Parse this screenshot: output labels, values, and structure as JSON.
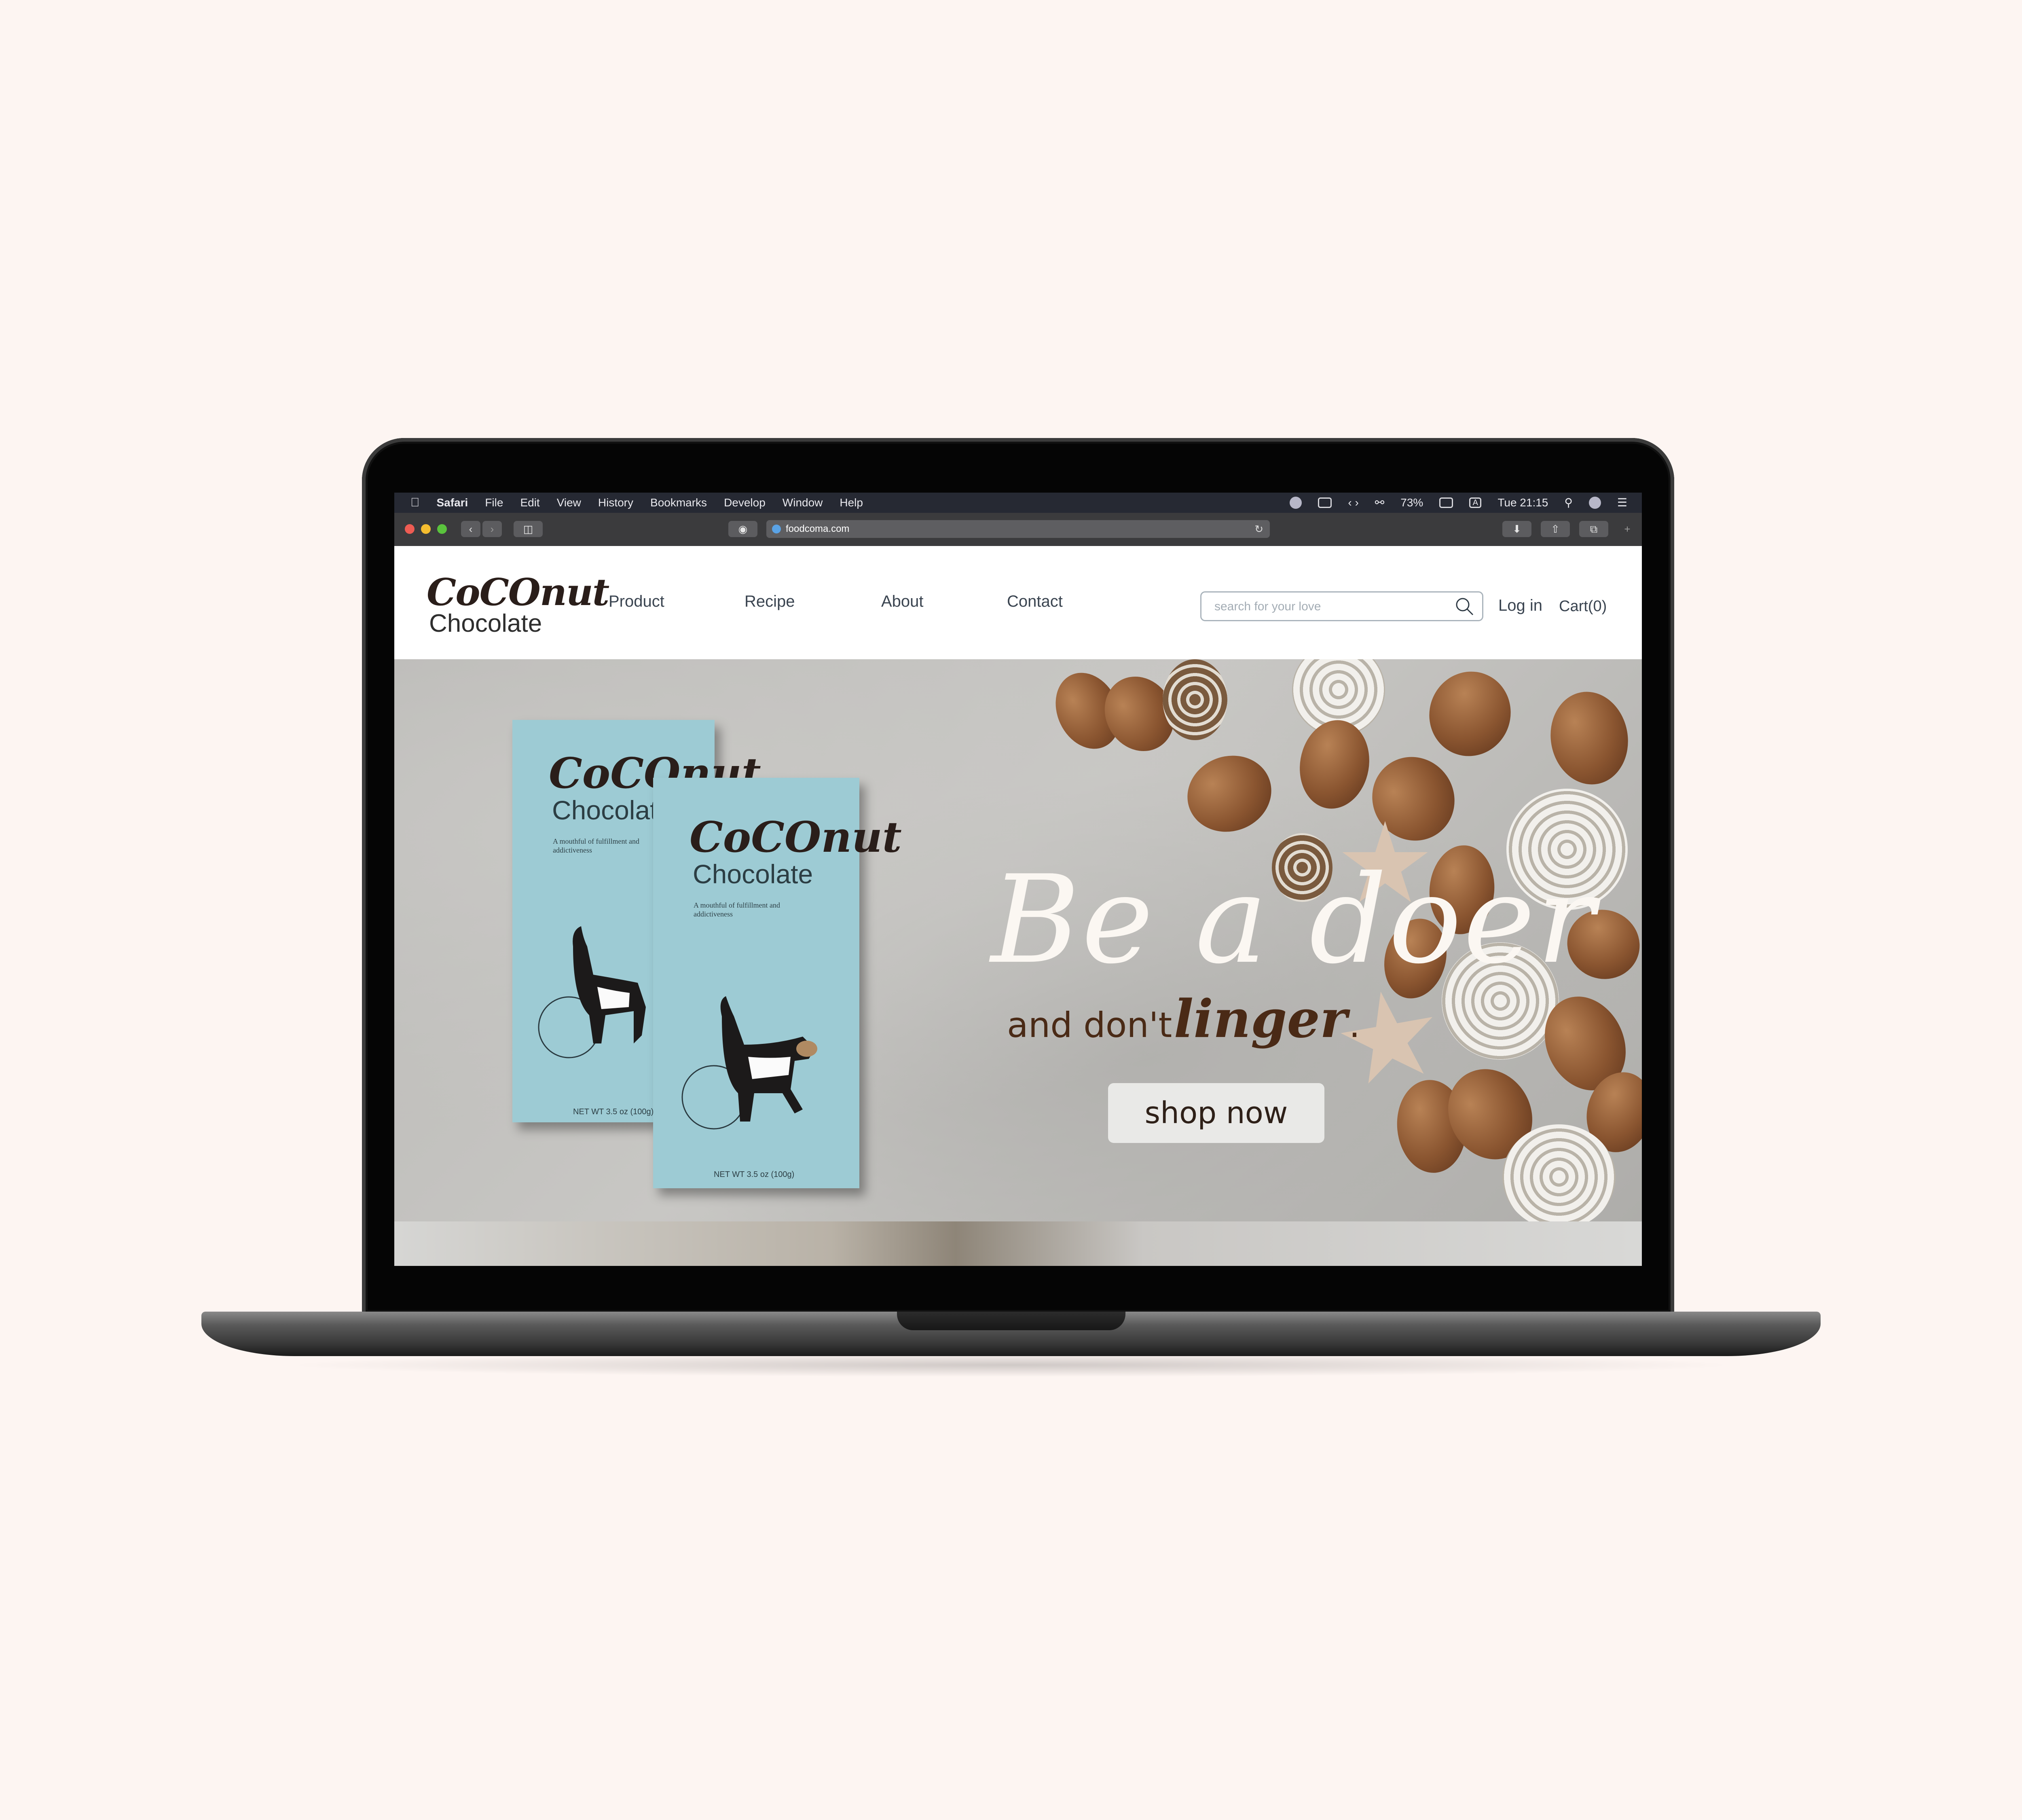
{
  "menubar": {
    "apple": "",
    "app": "Safari",
    "menus": [
      "File",
      "Edit",
      "View",
      "History",
      "Bookmarks",
      "Develop",
      "Window",
      "Help"
    ],
    "battery": "73%",
    "input_source": "A",
    "clock": "Tue 21:15"
  },
  "browser": {
    "url": "foodcoma.com"
  },
  "site": {
    "logo_top": "CoCOnut",
    "logo_bottom": "Chocolate",
    "nav": [
      "Product",
      "Recipe",
      "About",
      "Contact"
    ],
    "search_placeholder": "search for your love",
    "login": "Log in",
    "cart": "Cart(0)"
  },
  "hero": {
    "headline": "Be a doer",
    "tagline_start": "and don't",
    "tagline_emphasis": "linger",
    "tagline_end": ".",
    "cta": "shop now",
    "package": {
      "brand": "CoCOnut",
      "sub": "Chocolate",
      "tagline": "A mouthful of fulfillment and addictiveness",
      "weight": "NET WT 3.5 oz (100g)"
    }
  },
  "colors": {
    "background": "#fdf5f2",
    "package": "#9dcbd4",
    "accent_brown": "#4a2a16",
    "nav_text": "#3a4450"
  }
}
